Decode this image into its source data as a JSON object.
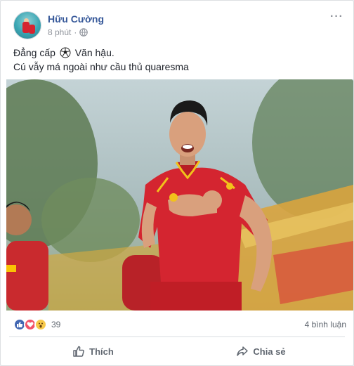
{
  "post": {
    "author": "Hữu Cường",
    "time": "8 phút",
    "privacy_icon": "globe-icon",
    "more_icon": "more-options-icon",
    "text_line1_before": "Đẳng cấp",
    "text_line1_after": "Văn hậu.",
    "text_line2": "Cú vẫy má ngoài như cầu thủ quaresma",
    "image_alt": "Cầu thủ mặc áo đỏ ăn mừng trên sân"
  },
  "reactions": {
    "icons": [
      "like-icon",
      "love-icon",
      "wow-icon"
    ],
    "count": "39",
    "comments": "4 bình luận"
  },
  "actions": {
    "like_label": "Thích",
    "share_label": "Chia sẻ"
  },
  "colors": {
    "name": "#365899",
    "like_blue": "#4267b2",
    "love_red": "#f25268",
    "wow_yellow": "#f7c94a"
  }
}
